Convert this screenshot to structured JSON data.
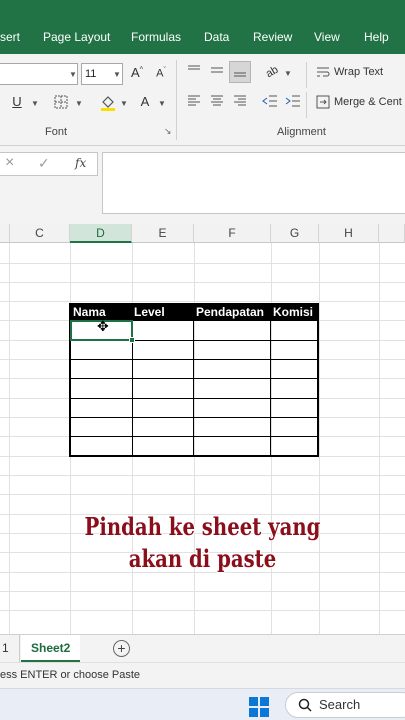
{
  "ribbon_tabs": [
    "sert",
    "Page Layout",
    "Formulas",
    "Data",
    "Review",
    "View",
    "Help"
  ],
  "font": {
    "size_value": "11",
    "grow_label": "A",
    "shrink_label": "A",
    "underline_label": "U",
    "font_color_label": "A",
    "group_label": "Font"
  },
  "alignment": {
    "wrap_text_label": "Wrap Text",
    "merge_label": "Merge & Cent",
    "group_label": "Alignment"
  },
  "formula_bar": {
    "cancel_symbol": "×",
    "confirm_symbol": "✓",
    "fx_label": "fx",
    "content": ""
  },
  "columns": [
    "C",
    "D",
    "E",
    "F",
    "G",
    "H"
  ],
  "selected_column": "D",
  "table": {
    "headers": [
      "Nama",
      "Level",
      "Pendapatan",
      "Komisi"
    ],
    "empty_rows": 7
  },
  "overlay_caption": {
    "line1": "Pindah ke sheet yang",
    "line2": "akan di paste"
  },
  "sheets": {
    "partial_tab": "1",
    "active_tab": "Sheet2",
    "add_symbol": "+"
  },
  "status_text": "ess ENTER or choose Paste",
  "taskbar": {
    "search_label": "Search"
  },
  "colors": {
    "excel_green": "#217346",
    "caption_red": "#8b0f1b",
    "windows_blue": "#0a78d4"
  }
}
